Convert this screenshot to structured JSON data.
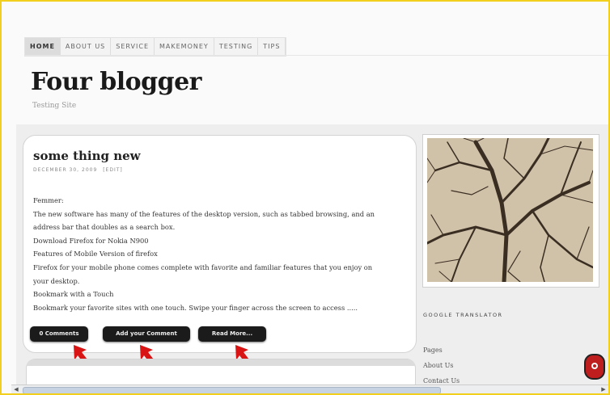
{
  "nav": {
    "items": [
      "HOME",
      "ABOUT US",
      "SERVICE",
      "MAKEMONEY",
      "TESTING",
      "TIPS"
    ]
  },
  "header": {
    "title": "Four blogger",
    "subtitle": "Testing Site"
  },
  "post": {
    "title": "some thing new",
    "date": "DECEMBER 30, 2009",
    "tag": "[EDIT]",
    "body": [
      "Femmer:",
      "The new software has many of the features of the desktop version, such as tabbed browsing, and an",
      "address bar that doubles as a search box.",
      "Download Firefox for Nokia N900",
      "Features of Mobile Version of firefox",
      "Firefox for your mobile phone comes complete with favorite and familiar features that you enjoy on",
      "your desktop.",
      "Bookmark with a Touch",
      "Bookmark your favorite sites with one touch. Swipe your finger across the screen to access ....."
    ],
    "buttons": {
      "comments": "0 Comments",
      "add_comment": "Add your Comment",
      "read_more": "Read More..."
    }
  },
  "sidebar": {
    "translator_title": "GOOGLE TRANSLATOR",
    "pages_label": "Pages",
    "links": [
      "About Us",
      "Contact Us"
    ]
  },
  "colors": {
    "frame_border": "#f2cf1c",
    "button_bg": "#1b1b1b",
    "arrow_red": "#d91414"
  },
  "icons": {
    "pointer_arrows": "red-arrow-icon",
    "corner": "gear-icon"
  }
}
